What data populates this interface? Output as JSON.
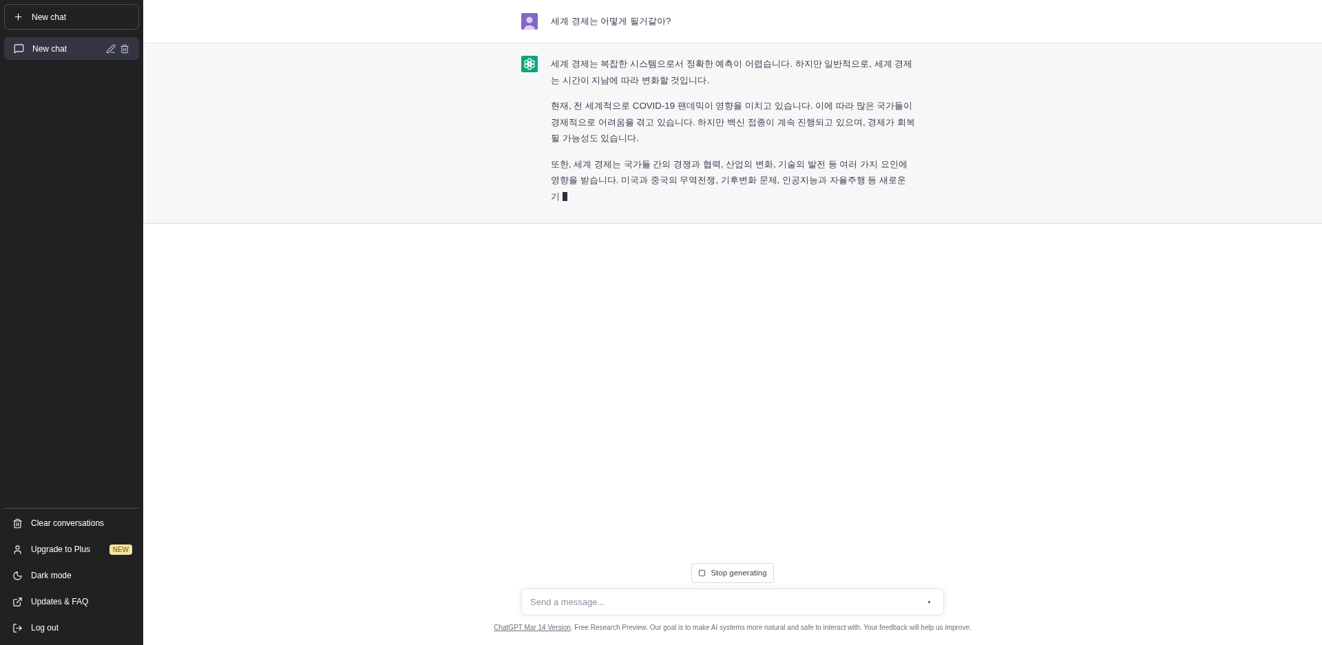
{
  "sidebar": {
    "new_chat_button": "New chat",
    "chats": [
      {
        "title": "New chat",
        "selected": true
      }
    ],
    "menu": [
      {
        "kind": "clear",
        "label": "Clear conversations"
      },
      {
        "kind": "upgrade",
        "label": "Upgrade to Plus",
        "badge": "NEW"
      },
      {
        "kind": "theme",
        "label": "Dark mode"
      },
      {
        "kind": "updates",
        "label": "Updates & FAQ"
      },
      {
        "kind": "logout",
        "label": "Log out"
      }
    ]
  },
  "conversation": [
    {
      "kind": "user",
      "paragraphs": [
        "세계 경제는 어떻게 될거같아?"
      ],
      "typing": false
    },
    {
      "kind": "assistant",
      "paragraphs": [
        "세계 경제는 복잡한 시스템으로서 정확한 예측이 어렵습니다. 하지만 일반적으로, 세계 경제는 시간이 지남에 따라 변화할 것입니다.",
        "현재, 전 세계적으로 COVID-19 팬데믹이 영향을 미치고 있습니다. 이에 따라 많은 국가들이 경제적으로 어려움을 겪고 있습니다. 하지만 백신 접종이 계속 진행되고 있으며, 경제가 회복될 가능성도 있습니다.",
        "또한, 세계 경제는 국가들 간의 경쟁과 협력, 산업의 변화, 기술의 발전 등 여러 가지 요인에 영향을 받습니다. 미국과 중국의 무역전쟁, 기후변화 문제, 인공지능과 자율주행 등 새로운 기"
      ],
      "typing": true
    }
  ],
  "stop_button": "Stop generating",
  "composer": {
    "placeholder": "Send a message..."
  },
  "footer": {
    "link": "ChatGPT Mar 14 Version",
    "text": ". Free Research Preview. Our goal is to make AI systems more natural and safe to interact with. Your feedback will help us improve."
  }
}
